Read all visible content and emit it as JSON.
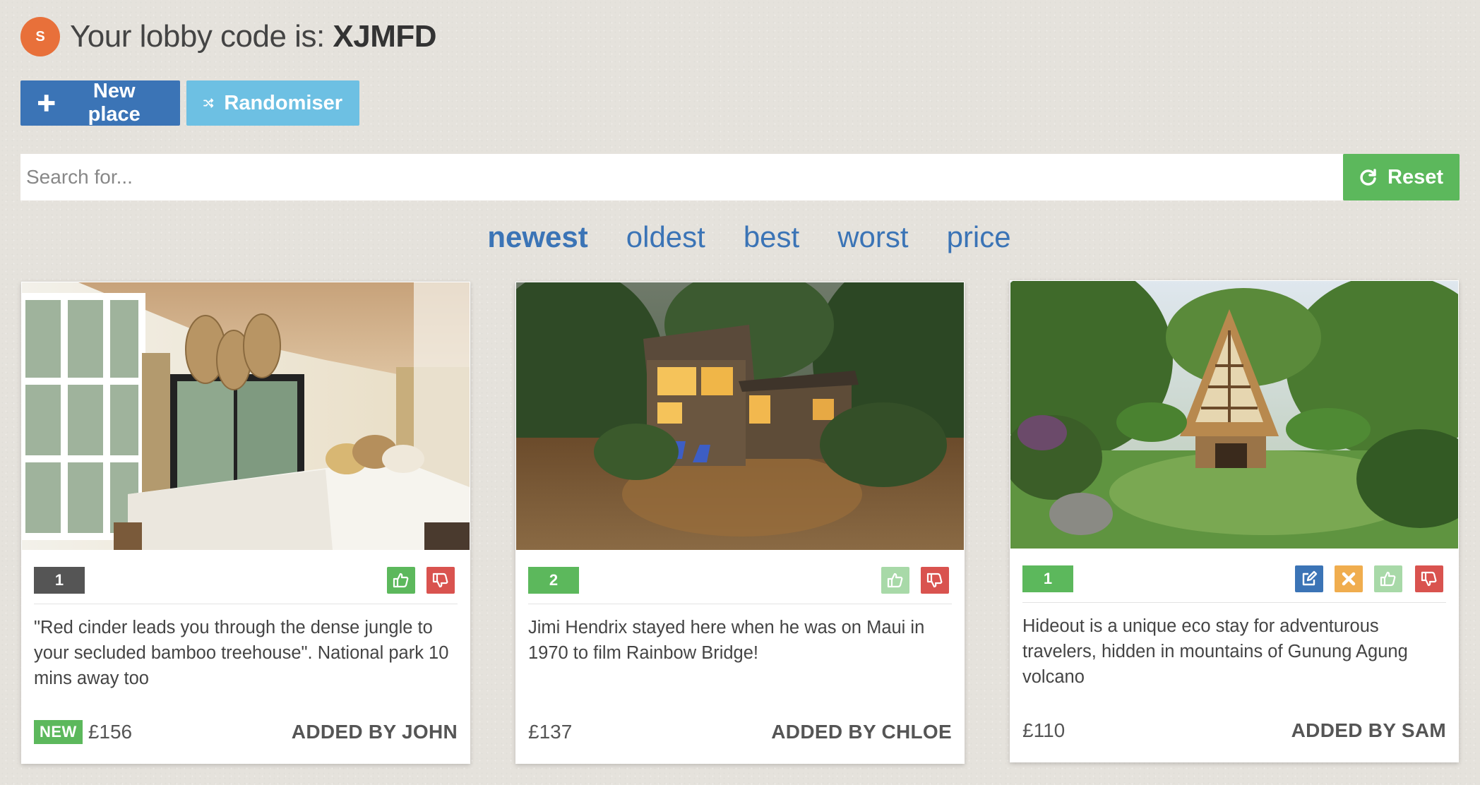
{
  "header": {
    "avatar_initial": "S",
    "lobby_label": "Your lobby code is: ",
    "lobby_code": "XJMFD"
  },
  "toolbar": {
    "new_place_label": "New place",
    "randomiser_label": "Randomiser"
  },
  "search": {
    "placeholder": "Search for...",
    "value": "",
    "reset_label": "Reset"
  },
  "sort": {
    "options": [
      "newest",
      "oldest",
      "best",
      "worst",
      "price"
    ],
    "active": "newest"
  },
  "colors": {
    "primary": "#3b74b6",
    "info": "#6dc0e3",
    "success": "#5cb85c",
    "danger": "#d9534f",
    "warning": "#f0ad4e",
    "rank_dark": "#555555"
  },
  "cards": [
    {
      "image": "bedroom-interior",
      "rank": "1",
      "rank_color": "#555555",
      "description": "\"Red cinder leads you through the dense jungle to your secluded bamboo treehouse\". National park 10 mins away too",
      "is_new": true,
      "new_label": "NEW",
      "price": "£156",
      "added_by": "ADDED BY JOHN",
      "actions": [
        "thumbs-up-icon",
        "thumbs-down-icon"
      ]
    },
    {
      "image": "jungle-cabin-evening",
      "rank": "2",
      "rank_color": "#5cb85c",
      "description": "Jimi Hendrix stayed here when he was on Maui in 1970 to film Rainbow Bridge!",
      "is_new": false,
      "price": "£137",
      "added_by": "ADDED BY CHLOE",
      "actions": [
        "thumbs-up-icon",
        "thumbs-down-icon"
      ]
    },
    {
      "image": "a-frame-bamboo-hut",
      "rank": "1",
      "rank_color": "#5cb85c",
      "description": "Hideout is a unique eco stay for adventurous travelers, hidden in mountains of Gunung Agung volcano",
      "is_new": false,
      "price": "£110",
      "added_by": "ADDED BY SAM",
      "actions": [
        "edit-icon",
        "close-icon",
        "thumbs-up-icon",
        "thumbs-down-icon"
      ]
    }
  ]
}
